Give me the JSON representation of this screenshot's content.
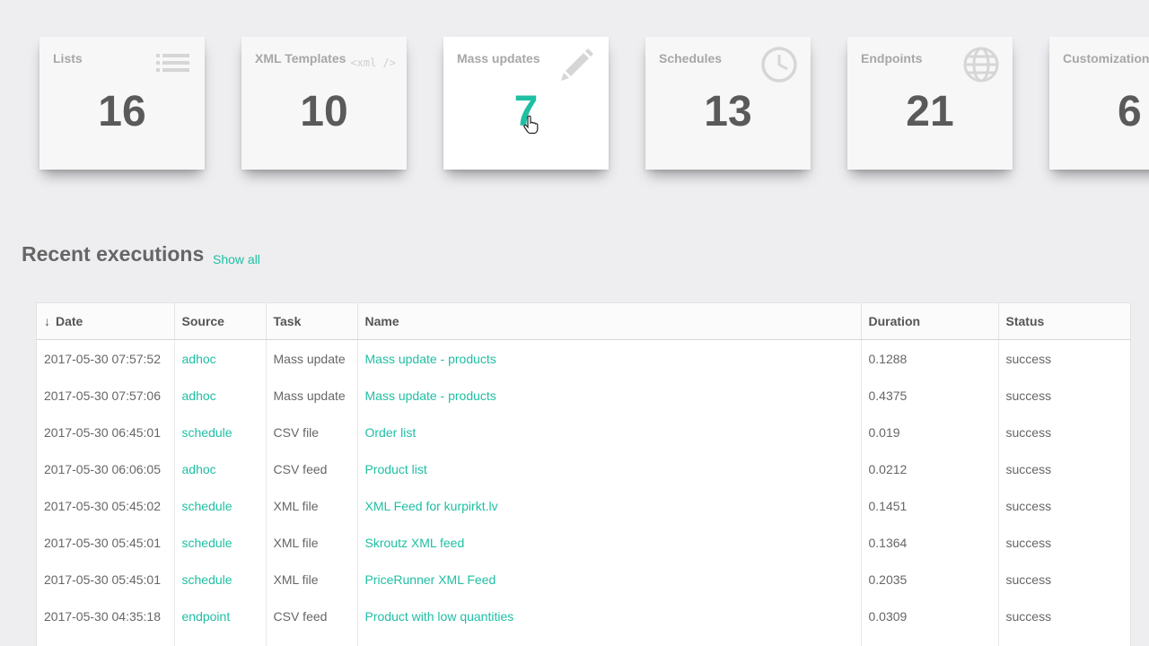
{
  "cards": [
    {
      "title": "Lists",
      "count": "16",
      "icon": "list-icon"
    },
    {
      "title": "XML Templates",
      "count": "10",
      "icon": "xml-icon",
      "icon_text": "<xml />"
    },
    {
      "title": "Mass updates",
      "count": "7",
      "icon": "pencil-icon"
    },
    {
      "title": "Schedules",
      "count": "13",
      "icon": "clock-icon"
    },
    {
      "title": "Endpoints",
      "count": "21",
      "icon": "globe-icon"
    },
    {
      "title": "Customization",
      "count": "6",
      "icon": ""
    }
  ],
  "recent": {
    "title": "Recent executions",
    "show_all": "Show all"
  },
  "table": {
    "sort_arrow": "↓",
    "headers": [
      "Date",
      "Source",
      "Task",
      "Name",
      "Duration",
      "Status"
    ],
    "rows": [
      [
        "2017-05-30 07:57:52",
        "adhoc",
        "Mass update",
        "Mass update - products",
        "0.1288",
        "success"
      ],
      [
        "2017-05-30 07:57:06",
        "adhoc",
        "Mass update",
        "Mass update - products",
        "0.4375",
        "success"
      ],
      [
        "2017-05-30 06:45:01",
        "schedule",
        "CSV file",
        "Order list",
        "0.019",
        "success"
      ],
      [
        "2017-05-30 06:06:05",
        "adhoc",
        "CSV feed",
        "Product list",
        "0.0212",
        "success"
      ],
      [
        "2017-05-30 05:45:02",
        "schedule",
        "XML file",
        "XML Feed for kurpirkt.lv",
        "0.1451",
        "success"
      ],
      [
        "2017-05-30 05:45:01",
        "schedule",
        "XML file",
        "Skroutz XML feed",
        "0.1364",
        "success"
      ],
      [
        "2017-05-30 05:45:01",
        "schedule",
        "XML file",
        "PriceRunner XML Feed",
        "0.2035",
        "success"
      ],
      [
        "2017-05-30 04:35:18",
        "endpoint",
        "CSV feed",
        "Product with low quantities",
        "0.0309",
        "success"
      ]
    ]
  },
  "colors": {
    "accent": "#1fbfa3",
    "background": "#eeeef1",
    "card": "#f7f7f8",
    "text": "#555555"
  }
}
